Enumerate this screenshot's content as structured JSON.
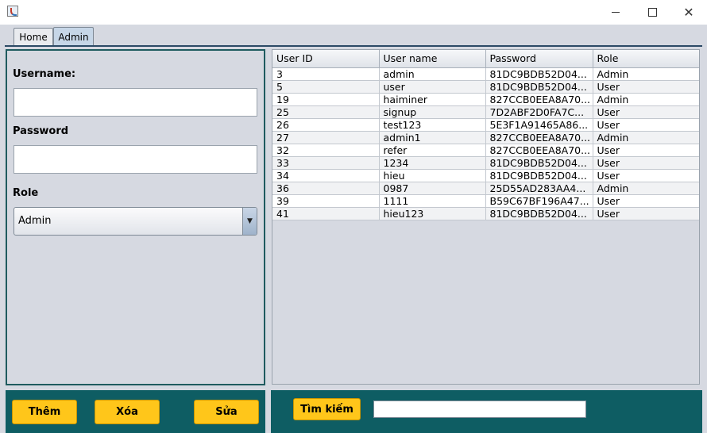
{
  "window": {
    "close_glyph": "✕"
  },
  "tabs": [
    {
      "label": "Home",
      "selected": false
    },
    {
      "label": "Admin",
      "selected": true
    }
  ],
  "form": {
    "username_label": "Username:",
    "username_value": "",
    "password_label": "Password",
    "password_value": "",
    "role_label": "Role",
    "role_selected": "Admin",
    "role_arrow": "▼"
  },
  "table": {
    "columns": [
      "User ID",
      "User name",
      "Password",
      "Role"
    ],
    "rows": [
      [
        "3",
        "admin",
        "81DC9BDB52D04...",
        "Admin"
      ],
      [
        "5",
        "user",
        "81DC9BDB52D04...",
        "User"
      ],
      [
        "19",
        "haiminer",
        "827CCB0EEA8A70...",
        "Admin"
      ],
      [
        "25",
        "signup",
        "7D2ABF2D0FA7C...",
        "User"
      ],
      [
        "26",
        "test123",
        "5E3F1A91465A86...",
        "User"
      ],
      [
        "27",
        "admin1",
        "827CCB0EEA8A70...",
        "Admin"
      ],
      [
        "32",
        "refer",
        "827CCB0EEA8A70...",
        "User"
      ],
      [
        "33",
        "1234",
        "81DC9BDB52D04...",
        "User"
      ],
      [
        "34",
        "hieu",
        "81DC9BDB52D04...",
        "User"
      ],
      [
        "36",
        "0987",
        "25D55AD283AA4...",
        "Admin"
      ],
      [
        "39",
        "1111",
        "B59C67BF196A47...",
        "User"
      ],
      [
        "41",
        "hieu123",
        "81DC9BDB52D04...",
        "User"
      ]
    ]
  },
  "actions": {
    "add_label": "Thêm",
    "delete_label": "Xóa",
    "edit_label": "Sửa",
    "search_label": "Tìm kiếm",
    "search_value": ""
  },
  "colors": {
    "panel_bg": "#d6d9e1",
    "bottom_bar": "#0e5d63",
    "button_yellow": "#ffc61a",
    "form_border": "#1f5b5f"
  }
}
